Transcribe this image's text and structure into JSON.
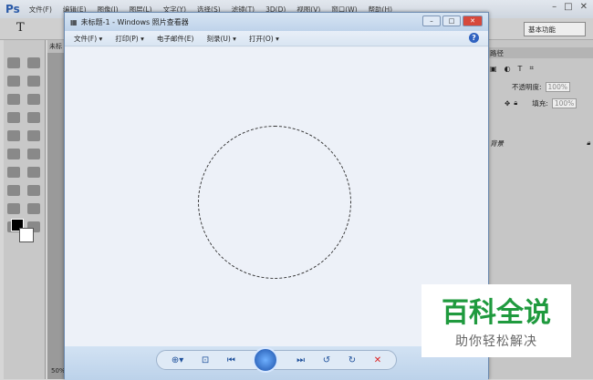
{
  "photoshop": {
    "logo": "Ps",
    "menu": [
      "文件(F)",
      "编辑(E)",
      "图像(I)",
      "图层(L)",
      "文字(Y)",
      "选择(S)",
      "滤镜(T)",
      "3D(D)",
      "视图(V)",
      "窗口(W)",
      "帮助(H)"
    ],
    "workspace": "基本功能",
    "doc_tab": "未标",
    "zoom": "50%",
    "panel_tab": "路径",
    "opacity_label": "不透明度:",
    "opacity": "100%",
    "fill_label": "填充:",
    "fill": "100%",
    "layer_name": "背景"
  },
  "viewer": {
    "title": "未标题-1 - Windows 照片查看器",
    "menu": [
      "文件(F)",
      "打印(P)",
      "电子邮件(E)",
      "刻录(U)",
      "打开(O)"
    ],
    "help": "?"
  },
  "watermark": {
    "title": "百科全说",
    "subtitle": "助你轻松解决"
  }
}
